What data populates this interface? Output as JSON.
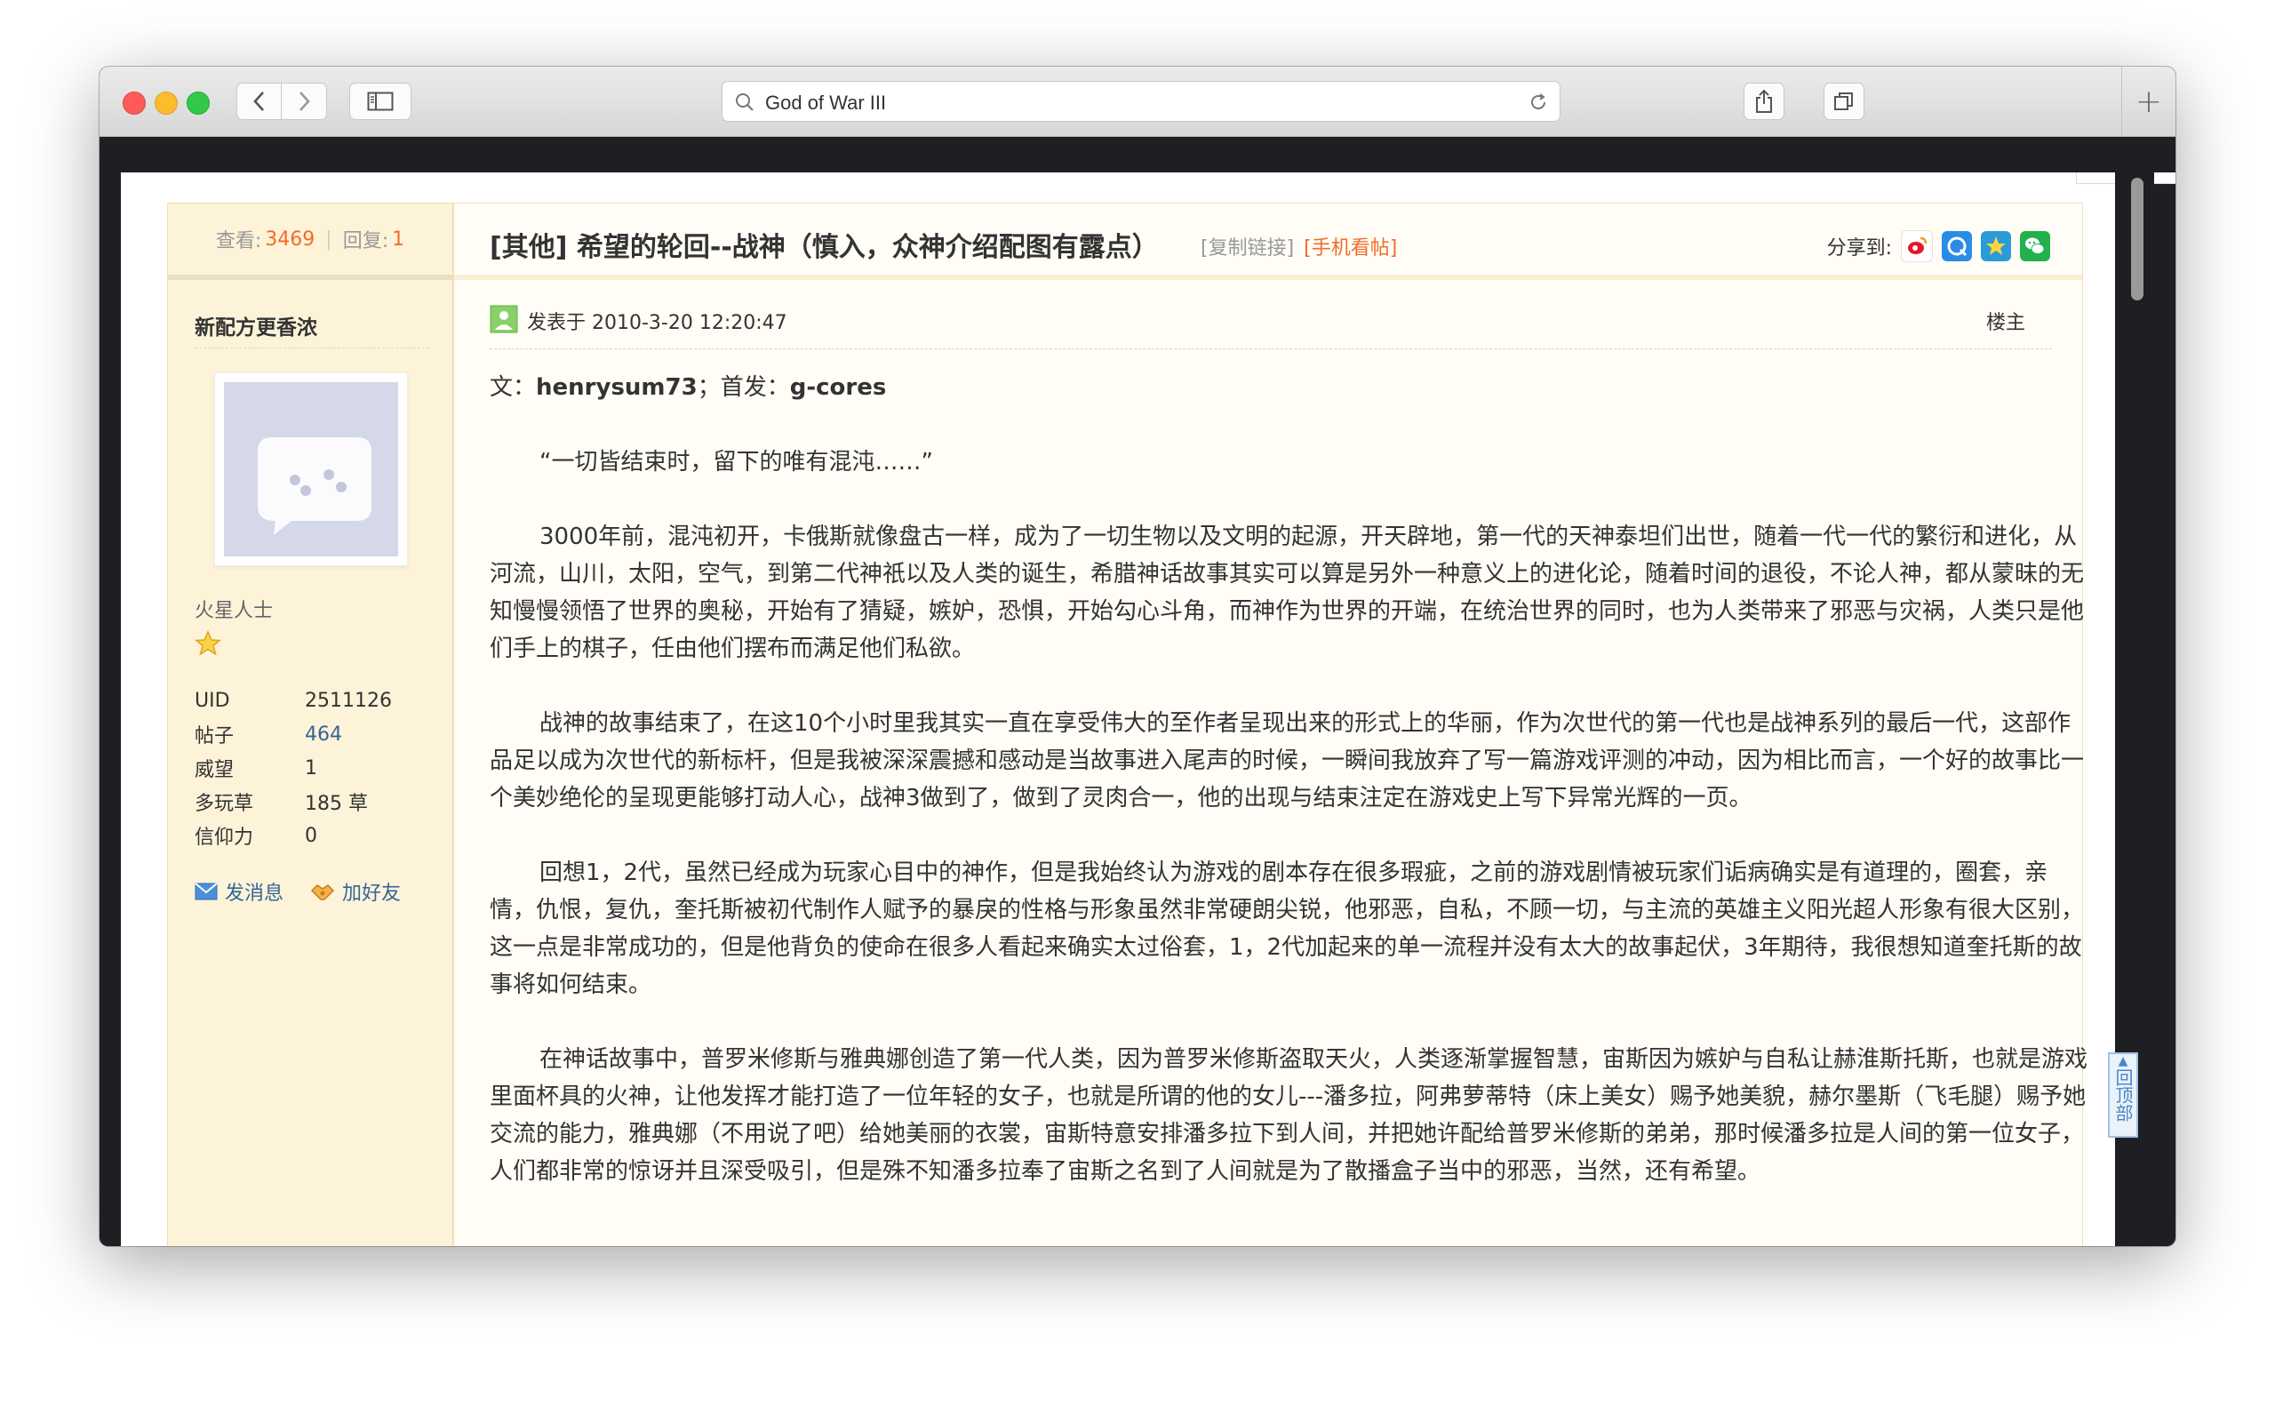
{
  "browser": {
    "address_text": "God of War III"
  },
  "stats": {
    "views_label": "查看:",
    "views": "3469",
    "sep": "|",
    "replies_label": "回复:",
    "replies": "1"
  },
  "user": {
    "name": "新配方更香浓",
    "group": "火星人士",
    "profile": [
      {
        "key": "UID",
        "value": "2511126",
        "link": false
      },
      {
        "key": "帖子",
        "value": "464",
        "link": true
      },
      {
        "key": "威望",
        "value": "1",
        "link": false
      },
      {
        "key": "多玩草",
        "value": "185 草",
        "link": false
      },
      {
        "key": "信仰力",
        "value": "0",
        "link": false
      }
    ],
    "actions": {
      "message": "发消息",
      "add_friend": "加好友"
    }
  },
  "post": {
    "title": "[其他] 希望的轮回--战神（慎入，众神介绍配图有露点）",
    "copy_link": "[复制链接]",
    "mobile_view": "[手机看帖]",
    "share_label": "分享到:",
    "posted_at": "发表于 2010-3-20 12:20:47",
    "floor": "楼主",
    "byline_prefix": "文：",
    "byline_author": "henrysum73",
    "byline_mid": "；首发：",
    "byline_source": "g-cores",
    "paragraphs": [
      "“一切皆结束时，留下的唯有混沌……”",
      "3000年前，混沌初开，卡俄斯就像盘古一样，成为了一切生物以及文明的起源，开天辟地，第一代的天神泰坦们出世，随着一代一代的繁衍和进化，从河流，山川，太阳，空气，到第二代神祇以及人类的诞生，希腊神话故事其实可以算是另外一种意义上的进化论，随着时间的退役，不论人神，都从蒙昧的无知慢慢领悟了世界的奥秘，开始有了猜疑，嫉妒，恐惧，开始勾心斗角，而神作为世界的开端，在统治世界的同时，也为人类带来了邪恶与灾祸，人类只是他们手上的棋子，任由他们摆布而满足他们私欲。",
      "战神的故事结束了，在这10个小时里我其实一直在享受伟大的至作者呈现出来的形式上的华丽，作为次世代的第一代也是战神系列的最后一代，这部作品足以成为次世代的新标杆，但是我被深深震撼和感动是当故事进入尾声的时候，一瞬间我放弃了写一篇游戏评测的冲动，因为相比而言，一个好的故事比一个美妙绝伦的呈现更能够打动人心，战神3做到了，做到了灵肉合一，他的出现与结束注定在游戏史上写下异常光辉的一页。",
      "回想1，2代，虽然已经成为玩家心目中的神作，但是我始终认为游戏的剧本存在很多瑕疵，之前的游戏剧情被玩家们诟病确实是有道理的，圈套，亲情，仇恨，复仇，奎托斯被初代制作人赋予的暴戾的性格与形象虽然非常硬朗尖锐，他邪恶，自私，不顾一切，与主流的英雄主义阳光超人形象有很大区别，这一点是非常成功的，但是他背负的使命在很多人看起来确实太过俗套，1，2代加起来的单一流程并没有太大的故事起伏，3年期待，我很想知道奎托斯的故事将如何结束。",
      "在神话故事中，普罗米修斯与雅典娜创造了第一代人类，因为普罗米修斯盗取天火，人类逐渐掌握智慧，宙斯因为嫉妒与自私让赫淮斯托斯，也就是游戏里面杯具的火神，让他发挥才能打造了一位年轻的女子，也就是所谓的他的女儿---潘多拉，阿弗萝蒂特（床上美女）赐予她美貌，赫尔墨斯（飞毛腿）赐予她交流的能力，雅典娜（不用说了吧）给她美丽的衣裳，宙斯特意安排潘多拉下到人间，并把她许配给普罗米修斯的弟弟，那时候潘多拉是人间的第一位女子，人们都非常的惊讶并且深受吸引，但是殊不知潘多拉奉了宙斯之名到了人间就是为了散播盒子当中的邪恶，当然，还有希望。"
    ]
  },
  "backtop": {
    "label": "回顶部"
  }
}
